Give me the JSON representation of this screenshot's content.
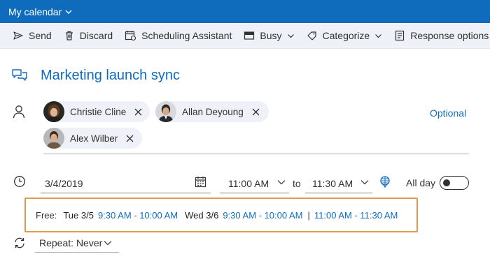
{
  "header": {
    "title": "My calendar"
  },
  "toolbar": {
    "send": "Send",
    "discard": "Discard",
    "scheduling": "Scheduling Assistant",
    "busy": "Busy",
    "categorize": "Categorize",
    "response": "Response options"
  },
  "event": {
    "title": "Marketing launch sync"
  },
  "attendees": {
    "people": [
      {
        "name": "Christie Cline"
      },
      {
        "name": "Allan Deyoung"
      },
      {
        "name": "Alex Wilber"
      }
    ],
    "optional_label": "Optional"
  },
  "datetime": {
    "date": "3/4/2019",
    "start": "11:00 AM",
    "to": "to",
    "end": "11:30 AM",
    "all_day": "All day",
    "all_day_on": false
  },
  "free": {
    "label": "Free:",
    "day1": "Tue 3/5",
    "day1_slot1": "9:30 AM - 10:00 AM",
    "day2": "Wed 3/6",
    "day2_slot1": "9:30 AM - 10:00 AM",
    "separator": "|",
    "day2_slot2": "11:00 AM - 11:30 AM"
  },
  "repeat": {
    "label": "Repeat:",
    "value": "Never"
  },
  "colors": {
    "accent": "#0f6cbd",
    "highlight": "#e39a50",
    "toolbar_bg": "#eef2f8"
  },
  "icons": [
    "chevron-down-icon",
    "send-icon",
    "trash-icon",
    "scheduling-icon",
    "busy-icon",
    "tag-icon",
    "response-icon",
    "chat-icon",
    "person-icon",
    "close-icon",
    "clock-icon",
    "calendar-icon",
    "room-icon",
    "repeat-icon"
  ]
}
